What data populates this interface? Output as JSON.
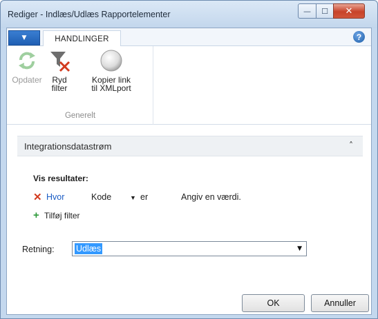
{
  "window": {
    "title": "Rediger - Indlæs/Udlæs Rapportelementer",
    "controls": {
      "minimize": "—",
      "maximize": "☐",
      "close": "✕"
    }
  },
  "ribbon": {
    "tab_active": "HANDLINGER",
    "help_glyph": "?",
    "app_menu_glyph": "▼",
    "buttons": {
      "refresh": {
        "label": "Opdater",
        "icon": "refresh-icon",
        "enabled": false
      },
      "clear_filter": {
        "line1": "Ryd",
        "line2": "filter",
        "icon": "clear-filter-icon"
      },
      "copy_link": {
        "line1": "Kopier link",
        "line2": "til XMLport",
        "icon": "copy-link-icon"
      }
    },
    "group_label": "Generelt"
  },
  "fasttab": {
    "title": "Integrationsdatastrøm",
    "chevron": "˄"
  },
  "filter": {
    "heading": "Vis resultater:",
    "remove_glyph": "✕",
    "where_label": "Hvor",
    "field": "Kode",
    "field_caret": "▼",
    "operator": "er",
    "value_placeholder": "Angiv en værdi.",
    "add_glyph": "+",
    "add_label": "Tilføj filter"
  },
  "direction": {
    "label": "Retning:",
    "value": "Udlæs",
    "arrow": "▼"
  },
  "buttons": {
    "ok": "OK",
    "cancel": "Annuller"
  },
  "colors": {
    "accent": "#1a5cc4",
    "selection": "#3399ff",
    "remove": "#d23a1e",
    "add": "#2e9a3a"
  }
}
